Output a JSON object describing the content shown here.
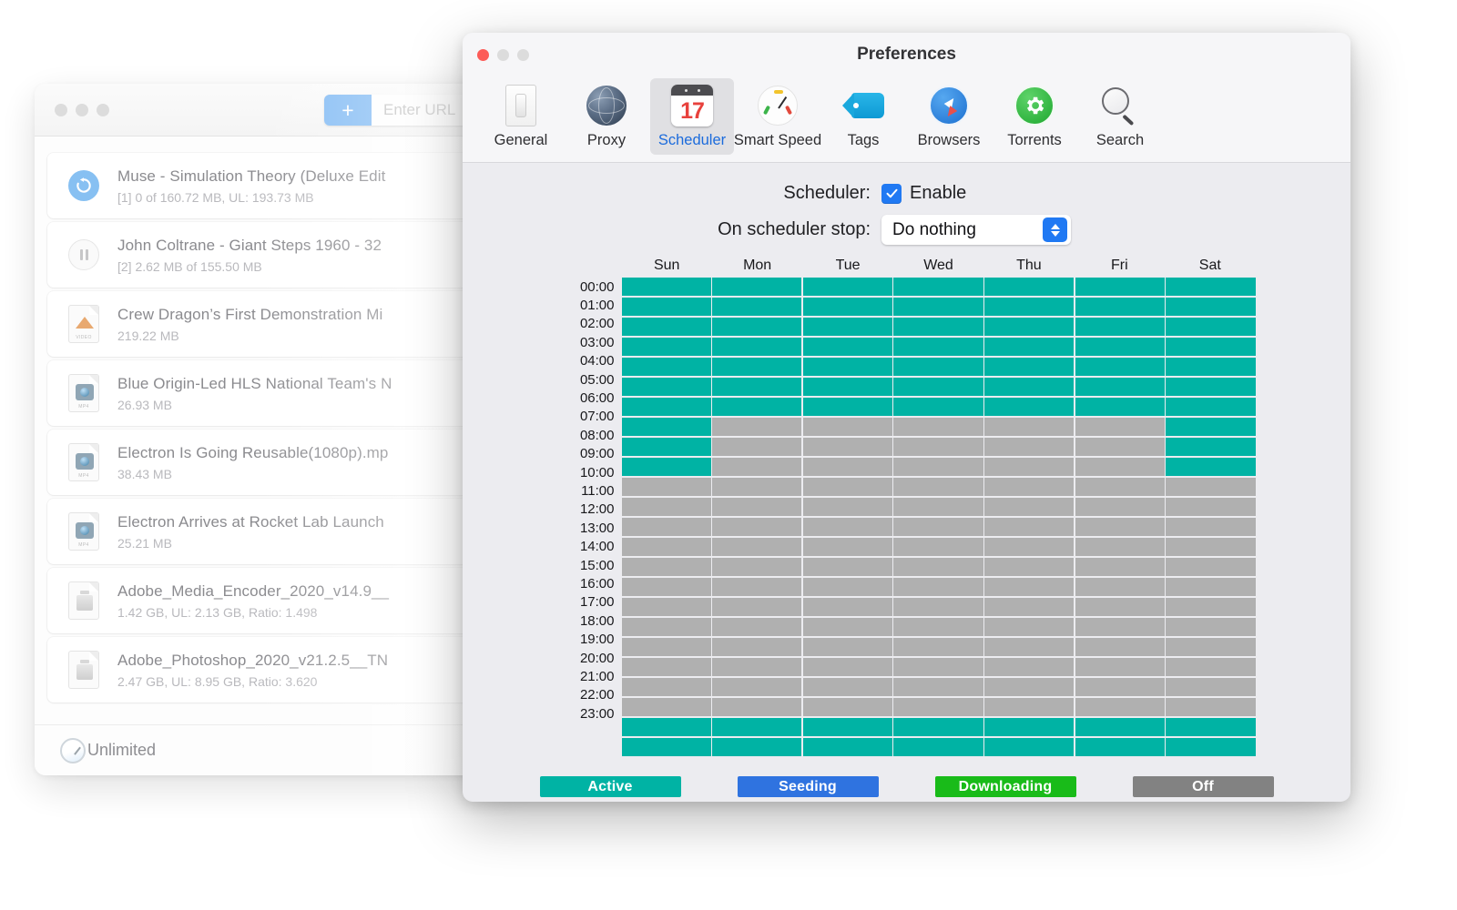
{
  "background_window": {
    "traffic_lights": [
      "close",
      "minimize",
      "maximize"
    ],
    "add_button_label": "+",
    "url_placeholder": "Enter URL",
    "downloads": [
      {
        "icon": "refresh-icon",
        "title": "Muse - Simulation Theory (Deluxe Edit",
        "subtitle": "[1] 0 of 160.72 MB, UL: 193.73 MB",
        "index": "[1]"
      },
      {
        "icon": "pause-icon",
        "title": "John Coltrane - Giant Steps 1960 - 32",
        "subtitle": "[2] 2.62 MB of 155.50 MB",
        "index": "[2]"
      },
      {
        "icon": "video-file-icon",
        "title": "Crew Dragon’s First Demonstration Mi",
        "subtitle": "219.22 MB",
        "index": ""
      },
      {
        "icon": "mp4-file-icon",
        "title": "Blue Origin-Led HLS National Team's N",
        "subtitle": "26.93 MB",
        "index": ""
      },
      {
        "icon": "mp4-file-icon",
        "title": "Electron Is Going Reusable(1080p).mp",
        "subtitle": "38.43 MB",
        "index": ""
      },
      {
        "icon": "mp4-file-icon",
        "title": "Electron Arrives at Rocket Lab Launch",
        "subtitle": "25.21 MB",
        "index": ""
      },
      {
        "icon": "zip-file-icon",
        "title": "Adobe_Media_Encoder_2020_v14.9__",
        "subtitle": "1.42 GB, UL: 2.13 GB, Ratio: 1.498",
        "index": ""
      },
      {
        "icon": "zip-file-icon",
        "title": "Adobe_Photoshop_2020_v21.2.5__TN",
        "subtitle": "2.47 GB, UL: 8.95 GB, Ratio: 3.620",
        "index": ""
      }
    ],
    "status_bar": {
      "speed_label": "Unlimited",
      "icon": "speed-gauge-icon"
    }
  },
  "prefs_window": {
    "title": "Preferences",
    "toolbar": [
      {
        "label": "General",
        "icon": "toggle-switch-icon",
        "selected": false
      },
      {
        "label": "Proxy",
        "icon": "globe-icon",
        "selected": false
      },
      {
        "label": "Scheduler",
        "icon": "calendar-icon",
        "selected": true,
        "badge": "17"
      },
      {
        "label": "Smart Speed",
        "icon": "speedometer-icon",
        "selected": false
      },
      {
        "label": "Tags",
        "icon": "tag-icon",
        "selected": false
      },
      {
        "label": "Browsers",
        "icon": "compass-icon",
        "selected": false
      },
      {
        "label": "Torrents",
        "icon": "gear-icon",
        "selected": false
      },
      {
        "label": "Search",
        "icon": "magnifier-icon",
        "selected": false
      }
    ],
    "scheduler_label": "Scheduler:",
    "enable_label": "Enable",
    "enable_checked": true,
    "on_stop_label": "On scheduler stop:",
    "on_stop_value": "Do nothing",
    "on_stop_options": [
      "Do nothing"
    ],
    "legend": [
      {
        "label": "Active",
        "color": "#00b3a4"
      },
      {
        "label": "Seeding",
        "color": "#2f73e0"
      },
      {
        "label": "Downloading",
        "color": "#19bb19"
      },
      {
        "label": "Off",
        "color": "#828282"
      }
    ]
  },
  "chart_data": {
    "type": "heatmap",
    "title": "Weekly download scheduler grid",
    "xlabel": "",
    "ylabel": "",
    "categories": [
      "Sun",
      "Mon",
      "Tue",
      "Wed",
      "Thu",
      "Fri",
      "Sat"
    ],
    "rows": [
      "00:00",
      "01:00",
      "02:00",
      "03:00",
      "04:00",
      "05:00",
      "06:00",
      "07:00",
      "08:00",
      "09:00",
      "10:00",
      "11:00",
      "12:00",
      "13:00",
      "14:00",
      "15:00",
      "16:00",
      "17:00",
      "18:00",
      "19:00",
      "20:00",
      "21:00",
      "22:00",
      "23:00"
    ],
    "state_colors": {
      "active": "#00b3a4",
      "seeding": "#2f73e0",
      "downloading": "#19bb19",
      "off": "#b0b0b0"
    },
    "values": [
      [
        "active",
        "active",
        "active",
        "active",
        "active",
        "active",
        "active"
      ],
      [
        "active",
        "active",
        "active",
        "active",
        "active",
        "active",
        "active"
      ],
      [
        "active",
        "active",
        "active",
        "active",
        "active",
        "active",
        "active"
      ],
      [
        "active",
        "active",
        "active",
        "active",
        "active",
        "active",
        "active"
      ],
      [
        "active",
        "active",
        "active",
        "active",
        "active",
        "active",
        "active"
      ],
      [
        "active",
        "active",
        "active",
        "active",
        "active",
        "active",
        "active"
      ],
      [
        "active",
        "active",
        "active",
        "active",
        "active",
        "active",
        "active"
      ],
      [
        "active",
        "off",
        "off",
        "off",
        "off",
        "off",
        "active"
      ],
      [
        "active",
        "off",
        "off",
        "off",
        "off",
        "off",
        "active"
      ],
      [
        "active",
        "off",
        "off",
        "off",
        "off",
        "off",
        "active"
      ],
      [
        "off",
        "off",
        "off",
        "off",
        "off",
        "off",
        "off"
      ],
      [
        "off",
        "off",
        "off",
        "off",
        "off",
        "off",
        "off"
      ],
      [
        "off",
        "off",
        "off",
        "off",
        "off",
        "off",
        "off"
      ],
      [
        "off",
        "off",
        "off",
        "off",
        "off",
        "off",
        "off"
      ],
      [
        "off",
        "off",
        "off",
        "off",
        "off",
        "off",
        "off"
      ],
      [
        "off",
        "off",
        "off",
        "off",
        "off",
        "off",
        "off"
      ],
      [
        "off",
        "off",
        "off",
        "off",
        "off",
        "off",
        "off"
      ],
      [
        "off",
        "off",
        "off",
        "off",
        "off",
        "off",
        "off"
      ],
      [
        "off",
        "off",
        "off",
        "off",
        "off",
        "off",
        "off"
      ],
      [
        "off",
        "off",
        "off",
        "off",
        "off",
        "off",
        "off"
      ],
      [
        "off",
        "off",
        "off",
        "off",
        "off",
        "off",
        "off"
      ],
      [
        "off",
        "off",
        "off",
        "off",
        "off",
        "off",
        "off"
      ],
      [
        "active",
        "active",
        "active",
        "active",
        "active",
        "active",
        "active"
      ],
      [
        "active",
        "active",
        "active",
        "active",
        "active",
        "active",
        "active"
      ]
    ]
  }
}
